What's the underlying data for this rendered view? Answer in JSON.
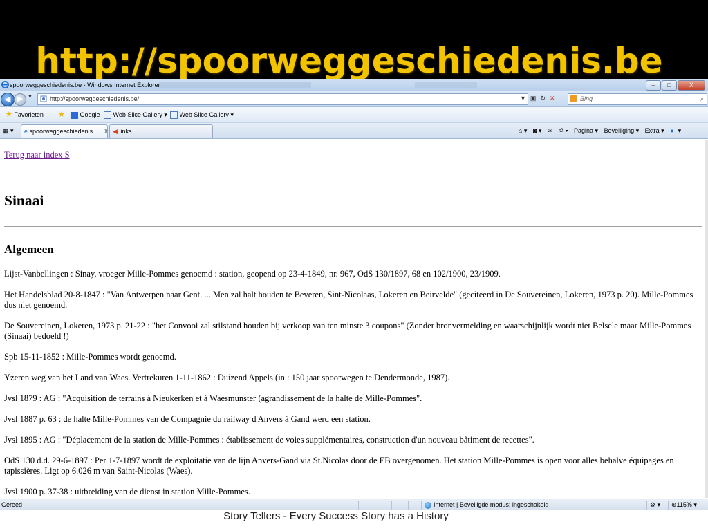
{
  "slide": {
    "title": "http://spoorweggeschiedenis.be",
    "footer": "Story Tellers - Every Success Story has a History",
    "title_color": "#f2c300",
    "header_bg": "#000000"
  },
  "browser": {
    "window_title": "spoorweggeschiedenis.be - Windows Internet Explorer",
    "window_buttons": [
      "–",
      "□",
      "X"
    ],
    "address": "http://spoorweggeschiedenis.be/",
    "search_placeholder": "Bing",
    "favorites_label": "Favorieten",
    "fav_links": [
      "Google",
      "Web Slice Gallery ▾",
      "Web Slice Gallery ▾"
    ],
    "tabs": [
      {
        "label": "spoorweggeschiedenis....",
        "close": "X"
      },
      {
        "label": "links"
      }
    ],
    "commands": {
      "page": "Pagina ▾",
      "safety": "Beveiliging ▾",
      "extra": "Extra ▾",
      "help": "▾"
    },
    "status": {
      "left": "Gereed",
      "zone": "Internet | Beveiligde modus: ingeschakeld",
      "zoom": "115%"
    }
  },
  "page": {
    "back_link": "Terug naar index S",
    "heading": "Sinaai",
    "subheading": "Algemeen",
    "paragraphs": [
      "Lijst-Vanbellingen : Sinay, vroeger Mille-Pommes genoemd : station, geopend op 23-4-1849, nr. 967, OdS 130/1897, 68 en 102/1900, 23/1909.",
      "Het Handelsblad 20-8-1847 : \"Van Antwerpen naar Gent. ... Men zal halt houden te Beveren, Sint-Nicolaas, Lokeren en Beirvelde\" (geciteerd in De Souvereinen, Lokeren, 1973 p. 20). Mille-Pommes dus niet genoemd.",
      "De Souvereinen, Lokeren, 1973 p. 21-22 : \"het Convooi zal stilstand houden bij verkoop van ten minste 3 coupons\" (Zonder bronvermelding en waarschijnlijk wordt niet Belsele maar Mille-Pommes (Sinaai) bedoeld !)",
      "Spb 15-11-1852 : Mille-Pommes wordt genoemd.",
      "Yzeren weg van het Land van Waes. Vertrekuren 1-11-1862 : Duizend Appels (in : 150 jaar spoorwegen te Dendermonde, 1987).",
      "Jvsl 1879 : AG : \"Acquisition de terrains à Nieukerken et à Waesmunster (agrandissement de la halte de Mille-Pommes\".",
      "Jvsl 1887 p. 63 : de halte Mille-Pommes van de Compagnie du railway d'Anvers à Gand werd een station.",
      "Jvsl 1895 : AG : \"Déplacement de la station de Mille-Pommes : établissement de voies supplémentaires, construction d'un nouveau bâtiment de recettes\".",
      "OdS 130 d.d. 29-6-1897 : Per 1-7-1897 wordt de exploitatie van de lijn Anvers-Gand via St.Nicolas door de EB overgenomen. Het station Mille-Pommes is open voor alles behalve équipages en tapissières. Ligt op 6.026 m van Saint-Nicolas (Waes).",
      "Jvsl 1900 p. 37-38 : uitbreiding van de dienst in station Mille-Pommes."
    ]
  }
}
